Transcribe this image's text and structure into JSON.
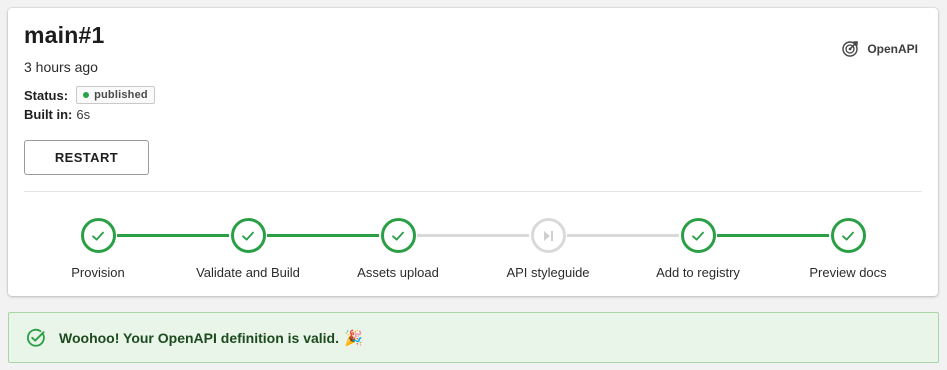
{
  "build": {
    "title": "main#1",
    "time_ago": "3 hours ago",
    "status_label": "Status:",
    "status_value": "published",
    "built_label": "Built in:",
    "built_value": "6s",
    "restart_label": "RESTART",
    "api_type": "OpenAPI"
  },
  "colors": {
    "success": "#2a9f46",
    "skipped": "#d9d9d9",
    "banner_bg": "#e9f5e8"
  },
  "pipeline": {
    "steps": [
      {
        "label": "Provision",
        "state": "done",
        "icon": "check-icon"
      },
      {
        "label": "Validate and Build",
        "state": "done",
        "icon": "check-icon"
      },
      {
        "label": "Assets upload",
        "state": "done",
        "icon": "check-icon"
      },
      {
        "label": "API styleguide",
        "state": "skipped",
        "icon": "skip-next-icon"
      },
      {
        "label": "Add to registry",
        "state": "done",
        "icon": "check-icon"
      },
      {
        "label": "Preview docs",
        "state": "done",
        "icon": "check-icon"
      }
    ]
  },
  "banner": {
    "message": "Woohoo! Your OpenAPI definition is valid.",
    "emoji": "🎉",
    "icon": "check-circle-icon"
  }
}
